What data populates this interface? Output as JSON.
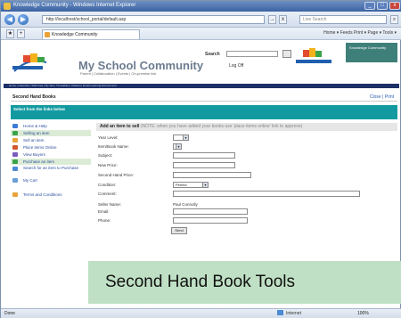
{
  "window": {
    "title": "Knowledge Community - Windows Internet Explorer",
    "minimize": "_",
    "maximize": "□",
    "close": "x"
  },
  "browser": {
    "back": "◀",
    "forward": "▶",
    "address": "http://localhost/school_portal/default.asp",
    "search_placeholder": "Live Search",
    "go": "→",
    "search_btn": "⌕",
    "tab_title": "Knowledge Community",
    "commands": "Home ▾  Feeds  Print ▾  Page ▾  Tools ▾"
  },
  "site": {
    "title": "My School Community",
    "subtitle": "Parent | Collaboration | Events | On-premise link",
    "login_label": "Search",
    "logoff": "Log Off",
    "teal_box": "Knowledge Community",
    "nav_strip": "Home | Calendar | Staff Area | My Site | Timetables | Classes | Email Learning Environment"
  },
  "page": {
    "heading": "Second Hand Books",
    "close_link": "Close | Print",
    "teal_label": "Select from the links below"
  },
  "sidebar": {
    "items": [
      {
        "label": "Home & Help"
      },
      {
        "label": "Selling an item"
      },
      {
        "label": "Sell an item"
      },
      {
        "label": "Place items Online"
      },
      {
        "label": "View Buyers"
      },
      {
        "label": "Purchase an item"
      },
      {
        "label": "Search for an item to Purchase"
      },
      {
        "label": "My Cart"
      },
      {
        "label": "Terms and Conditions"
      }
    ]
  },
  "form": {
    "heading": "Add an item to sell",
    "heading_note": "(NOTE: when you have added your books use 'place items online' link to approve)",
    "fields": [
      {
        "label": "Year Level:",
        "value": ""
      },
      {
        "label": "Item/Book Name:",
        "value": ""
      },
      {
        "label": "Subject:",
        "value": ""
      },
      {
        "label": "New Price:",
        "value": ""
      },
      {
        "label": "Second Hand Price:",
        "value": ""
      },
      {
        "label": "Condition:",
        "value": "Perfect"
      },
      {
        "label": "Comment:",
        "value": ""
      },
      {
        "label": "Seller Name:",
        "value": "Paul Connolly"
      },
      {
        "label": "Email:",
        "value": ""
      },
      {
        "label": "Phone:",
        "value": ""
      }
    ],
    "send": "Send"
  },
  "status": {
    "left": "Done",
    "zone": "Internet",
    "zoom": "100%"
  },
  "caption": "Second Hand Book Tools"
}
